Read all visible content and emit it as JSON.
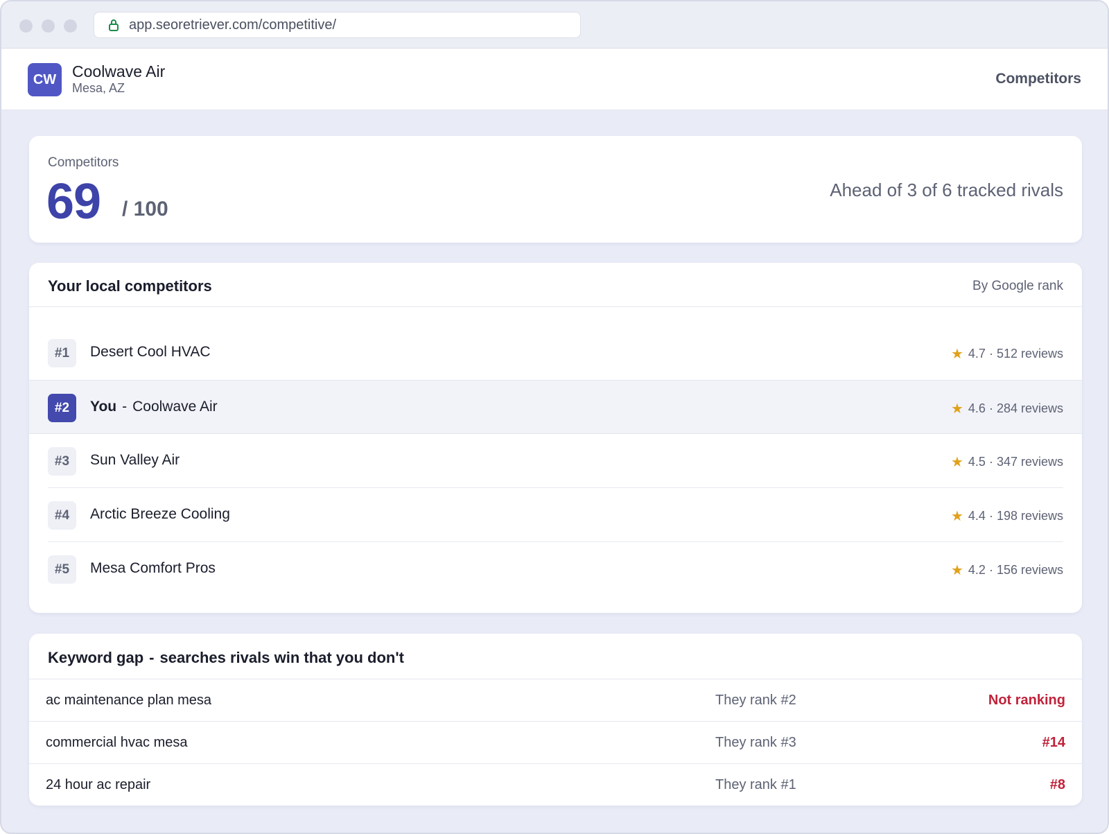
{
  "browser": {
    "url": "app.seoretriever.com/competitive/"
  },
  "header": {
    "avatar_initials": "CW",
    "business_name": "Coolwave Air",
    "location": "Mesa, AZ",
    "nav_title": "Competitors"
  },
  "score": {
    "label": "Competitors",
    "value": "69",
    "max_label": "/ 100",
    "summary": "Ahead of 3 of 6 tracked rivals"
  },
  "competitors": {
    "title": "Your local competitors",
    "sort_label": "By Google rank",
    "rows": [
      {
        "rank": "#1",
        "name": "Desert Cool HVAC",
        "rating": "4.7",
        "reviews": "512 reviews"
      },
      {
        "rank": "#2",
        "you_tag": "You",
        "name": "Coolwave Air",
        "rating": "4.6",
        "reviews": "284 reviews"
      },
      {
        "rank": "#3",
        "name": "Sun Valley Air",
        "rating": "4.5",
        "reviews": "347 reviews"
      },
      {
        "rank": "#4",
        "name": "Arctic Breeze Cooling",
        "rating": "4.4",
        "reviews": "198 reviews"
      },
      {
        "rank": "#5",
        "name": "Mesa Comfort Pros",
        "rating": "4.2",
        "reviews": "156 reviews"
      }
    ]
  },
  "keyword_gap": {
    "title_main": "Keyword gap",
    "title_sub": "searches rivals win that you don't",
    "rows": [
      {
        "term": "ac maintenance plan mesa",
        "they": "They rank #2",
        "you": "Not ranking"
      },
      {
        "term": "commercial hvac mesa",
        "they": "They rank #3",
        "you": "#14"
      },
      {
        "term": "24 hour ac repair",
        "they": "They rank #1",
        "you": "#8"
      }
    ]
  },
  "colors": {
    "accent": "#4349ad",
    "negative": "#c0223a",
    "star": "#e0a11b"
  }
}
